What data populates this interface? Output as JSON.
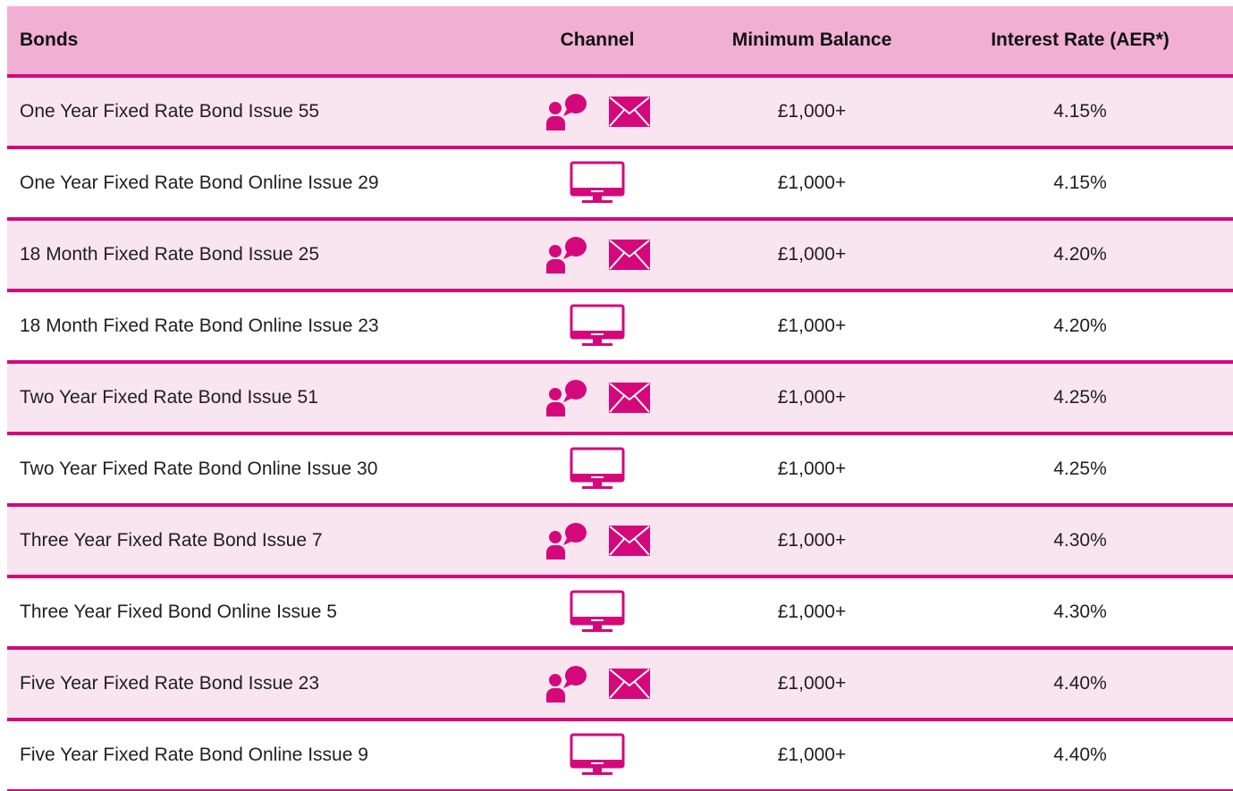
{
  "headers": {
    "bonds": "Bonds",
    "channel": "Channel",
    "min_balance": "Minimum Balance",
    "rate": "Interest Rate (AER*)"
  },
  "colors": {
    "accent": "#d4087b",
    "header_bg": "#f1b0d3",
    "row_alt_bg": "#f9e5ef"
  },
  "rows": [
    {
      "name": "One Year Fixed Rate Bond Issue 55",
      "channel": "branch-post",
      "min": "£1,000+",
      "rate": "4.15%"
    },
    {
      "name": "One Year Fixed Rate Bond Online Issue 29",
      "channel": "online",
      "min": "£1,000+",
      "rate": "4.15%"
    },
    {
      "name": "18 Month Fixed Rate Bond Issue 25",
      "channel": "branch-post",
      "min": "£1,000+",
      "rate": "4.20%"
    },
    {
      "name": "18 Month Fixed Rate Bond Online Issue 23",
      "channel": "online",
      "min": "£1,000+",
      "rate": "4.20%"
    },
    {
      "name": "Two Year Fixed Rate Bond Issue 51",
      "channel": "branch-post",
      "min": "£1,000+",
      "rate": "4.25%"
    },
    {
      "name": "Two Year Fixed Rate Bond Online Issue 30",
      "channel": "online",
      "min": "£1,000+",
      "rate": "4.25%"
    },
    {
      "name": "Three Year Fixed Rate Bond Issue 7",
      "channel": "branch-post",
      "min": "£1,000+",
      "rate": "4.30%"
    },
    {
      "name": "Three Year Fixed Bond Online Issue 5",
      "channel": "online",
      "min": "£1,000+",
      "rate": "4.30%"
    },
    {
      "name": "Five Year Fixed Rate Bond Issue 23",
      "channel": "branch-post",
      "min": "£1,000+",
      "rate": "4.40%"
    },
    {
      "name": "Five Year Fixed Rate Bond Online Issue 9",
      "channel": "online",
      "min": "£1,000+",
      "rate": "4.40%"
    }
  ],
  "icons": {
    "branch": "person-speech-icon",
    "post": "envelope-icon",
    "online": "computer-monitor-icon"
  }
}
